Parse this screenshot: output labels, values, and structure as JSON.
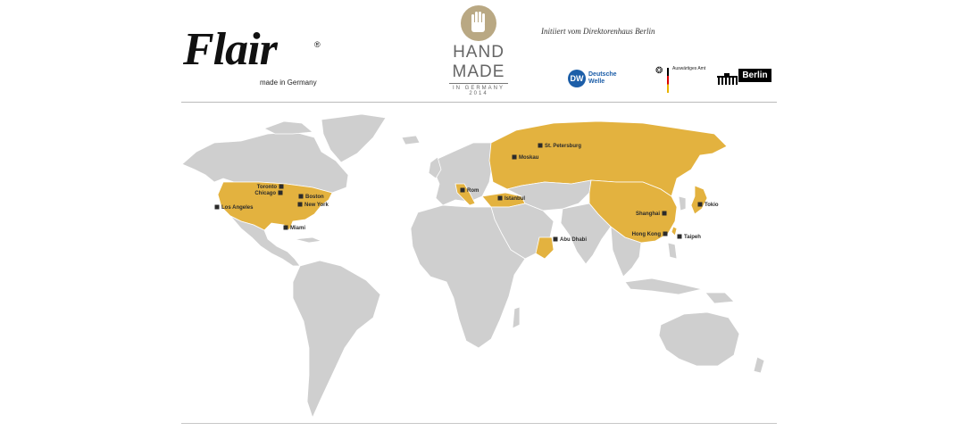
{
  "brand": {
    "wordmark": "Flair",
    "registered": "®",
    "tagline": "made in Germany"
  },
  "handmade": {
    "line1": "HAND",
    "line2": "MADE",
    "line3": "IN GERMANY",
    "line4": "2014"
  },
  "initiative": "Initiiert vom Direktorenhaus Berlin",
  "partners": {
    "dw": {
      "mark": "DW",
      "line1": "Deutsche",
      "line2": "Welle"
    },
    "aa": {
      "label": "Auswärtiges Amt"
    },
    "berlin": {
      "label": "Berlin"
    }
  },
  "colors": {
    "highlight": "#e3b23f",
    "land": "#cfcfcf",
    "marker": "#2b2b2b"
  },
  "cities": [
    {
      "name": "Toronto",
      "anchor": "left"
    },
    {
      "name": "Chicago",
      "anchor": "left"
    },
    {
      "name": "Boston",
      "anchor": "right"
    },
    {
      "name": "New York",
      "anchor": "right"
    },
    {
      "name": "Los Angeles",
      "anchor": "right"
    },
    {
      "name": "Miami",
      "anchor": "right"
    },
    {
      "name": "St. Petersburg",
      "anchor": "right"
    },
    {
      "name": "Moskau",
      "anchor": "right"
    },
    {
      "name": "Rom",
      "anchor": "right"
    },
    {
      "name": "Istanbul",
      "anchor": "right"
    },
    {
      "name": "Abu Dhabi",
      "anchor": "right"
    },
    {
      "name": "Shanghai",
      "anchor": "left"
    },
    {
      "name": "Tokio",
      "anchor": "right"
    },
    {
      "name": "Hong Kong",
      "anchor": "left"
    },
    {
      "name": "Taipeh",
      "anchor": "right"
    }
  ]
}
